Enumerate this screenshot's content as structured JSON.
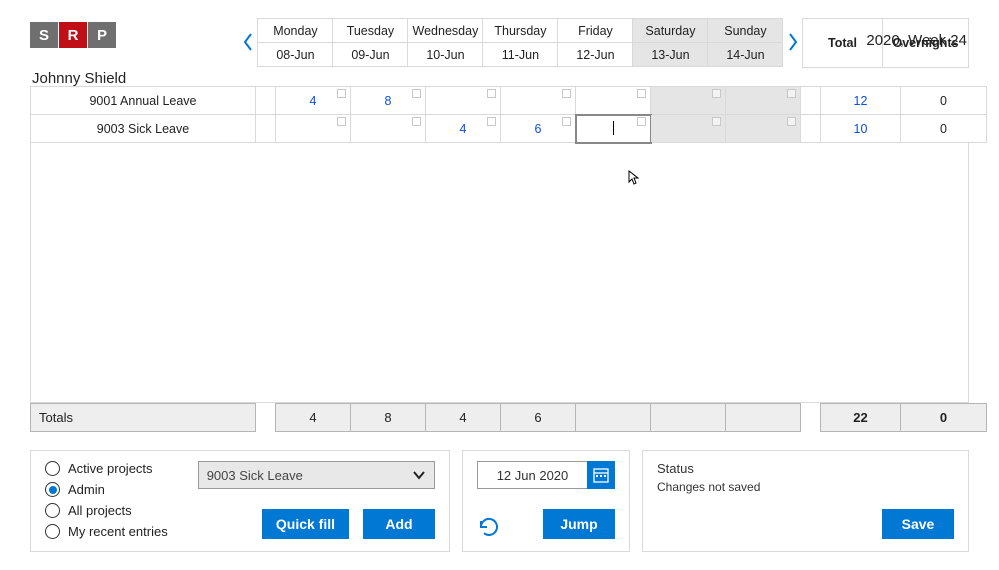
{
  "header": {
    "logo_letters": [
      "S",
      "R",
      "P"
    ],
    "user_name": "Johnny Shield",
    "week_label": "2020, Week 24"
  },
  "days": [
    {
      "name": "Monday",
      "date": "08-Jun",
      "weekend": false
    },
    {
      "name": "Tuesday",
      "date": "09-Jun",
      "weekend": false
    },
    {
      "name": "Wednesday",
      "date": "10-Jun",
      "weekend": false
    },
    {
      "name": "Thursday",
      "date": "11-Jun",
      "weekend": false
    },
    {
      "name": "Friday",
      "date": "12-Jun",
      "weekend": false
    },
    {
      "name": "Saturday",
      "date": "13-Jun",
      "weekend": true
    },
    {
      "name": "Sunday",
      "date": "14-Jun",
      "weekend": true
    }
  ],
  "col_headers": {
    "total": "Total",
    "overnights": "Overnights"
  },
  "rows": [
    {
      "project": "9001 Annual Leave",
      "cells": [
        "4",
        "8",
        "",
        "",
        "",
        "",
        ""
      ],
      "total": "12",
      "overnights": "0",
      "active_col": null
    },
    {
      "project": "9003 Sick Leave",
      "cells": [
        "",
        "",
        "4",
        "6",
        "",
        "",
        ""
      ],
      "total": "10",
      "overnights": "0",
      "active_col": 4
    }
  ],
  "totals": {
    "label": "Totals",
    "cells": [
      "4",
      "8",
      "4",
      "6",
      "",
      "",
      ""
    ],
    "total": "22",
    "overnights": "0"
  },
  "filter": {
    "options": [
      "Active projects",
      "Admin",
      "All projects",
      "My recent entries"
    ],
    "selected_index": 1,
    "combo_value": "9003 Sick Leave",
    "quickfill": "Quick fill",
    "add": "Add"
  },
  "jumper": {
    "date": "12 Jun 2020",
    "jump": "Jump"
  },
  "status": {
    "title": "Status",
    "message": "Changes not saved",
    "save": "Save"
  },
  "colors": {
    "accent": "#0078d4",
    "link": "#0b4fdf",
    "weekend": "#e5e5e5"
  }
}
